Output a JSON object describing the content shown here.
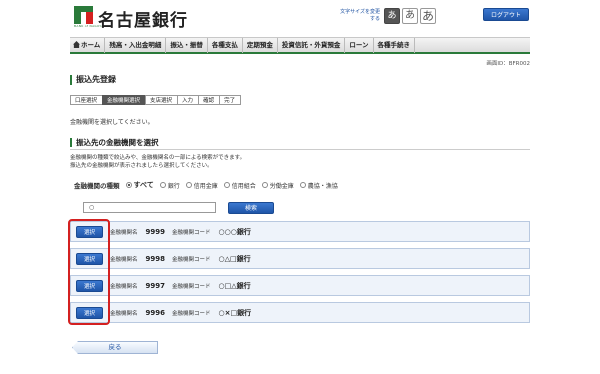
{
  "header": {
    "logo_sub": "BANK of NAGOYA",
    "bank_name": "名古屋銀行",
    "font_size_label": "文字サイズを変更する",
    "font_size_buttons": [
      "あ",
      "あ",
      "あ"
    ],
    "logout_label": "ログアウト"
  },
  "nav": {
    "items": [
      "ホーム",
      "残高・入出金明細",
      "振込・振替",
      "各種支払",
      "定期預金",
      "投資信託・外貨預金",
      "ローン",
      "各種手続き"
    ]
  },
  "screen_id": "画面ID：BFR002",
  "page_title": "振込先登録",
  "steps": [
    "口座選択",
    "金融機関選択",
    "支店選択",
    "入力",
    "確認",
    "完了"
  ],
  "active_step_index": 1,
  "instruction": "金融機関を選択してください。",
  "section": {
    "title": "振込先の金融機関を選択",
    "desc_line1": "金融機関の種類で絞込みや、金融機関名の一部による検索ができます。",
    "desc_line2": "振込先の金融機関が表示されましたら選択してください。"
  },
  "type_filter": {
    "label": "金融機関の種類",
    "options": [
      "すべて",
      "銀行",
      "信用金庫",
      "信用組合",
      "労働金庫",
      "農協・漁協"
    ],
    "selected_index": 0
  },
  "search": {
    "input_value": "○",
    "button_label": "検索"
  },
  "results": [
    {
      "select_label": "選択",
      "name_label": "金融機関名",
      "code": "9999",
      "code_label": "金融機関コード",
      "name": "○○○銀行"
    },
    {
      "select_label": "選択",
      "name_label": "金融機関名",
      "code": "9998",
      "code_label": "金融機関コード",
      "name": "○△□銀行"
    },
    {
      "select_label": "選択",
      "name_label": "金融機関名",
      "code": "9997",
      "code_label": "金融機関コード",
      "name": "○□△銀行"
    },
    {
      "select_label": "選択",
      "name_label": "金融機関名",
      "code": "9996",
      "code_label": "金融機関コード",
      "name": "○×□銀行"
    }
  ],
  "back_label": "戻る",
  "colors": {
    "brand_green": "#2a7a3a",
    "button_blue": "#1f55a8",
    "highlight_red": "#d42020"
  }
}
